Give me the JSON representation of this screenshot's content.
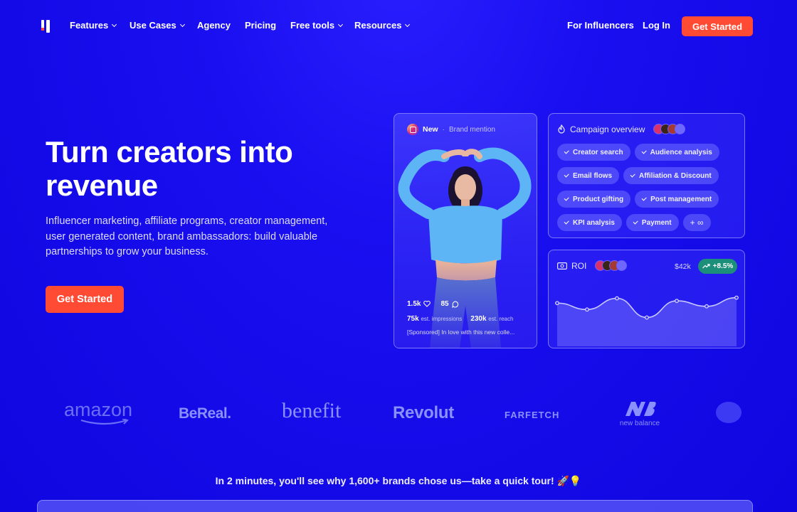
{
  "nav": {
    "items": [
      {
        "label": "Features",
        "dropdown": true
      },
      {
        "label": "Use Cases",
        "dropdown": true
      },
      {
        "label": "Agency",
        "dropdown": false
      },
      {
        "label": "Pricing",
        "dropdown": false
      },
      {
        "label": "Free tools",
        "dropdown": true
      },
      {
        "label": "Resources",
        "dropdown": true
      }
    ],
    "influencers": "For Influencers",
    "login": "Log In",
    "cta": "Get Started"
  },
  "hero": {
    "title": "Turn creators into revenue",
    "subtitle": "Influencer marketing, affiliate programs, creator management, user generated content, brand ambassadors: build valuable partnerships to grow your business.",
    "cta": "Get Started"
  },
  "post": {
    "badge": "New",
    "separator": "·",
    "type": "Brand mention",
    "likes": "1.5k",
    "comments": "85",
    "impressions": "75k",
    "impressions_label": "est. impressions",
    "reach": "230k",
    "reach_label": "est. reach",
    "caption": "[Sponsored] In love with this new colle..."
  },
  "campaign": {
    "title": "Campaign overview",
    "tags": [
      "Creator search",
      "Audience analysis",
      "Email flows",
      "Affiliation & Discount",
      "Product gifting",
      "Post management",
      "KPI analysis",
      "Payment"
    ],
    "more": "+ ∞"
  },
  "roi": {
    "title": "ROI",
    "value": "$42k",
    "change": "+8.5%",
    "series": [
      0.55,
      0.35,
      0.7,
      0.1,
      0.62,
      0.45,
      0.72
    ]
  },
  "brands": [
    "amazon",
    "BeReal.",
    "benefit",
    "Revolut",
    "FARFETCH",
    "new balance"
  ],
  "tour": {
    "text": "In 2 minutes, you'll see why 1,600+ brands chose us—take a quick tour! 🚀💡"
  },
  "colors": {
    "background": "#1408e8",
    "accent": "#ff4a34",
    "positive": "#1b8f7a",
    "logo_gray": "#8b90ff"
  }
}
